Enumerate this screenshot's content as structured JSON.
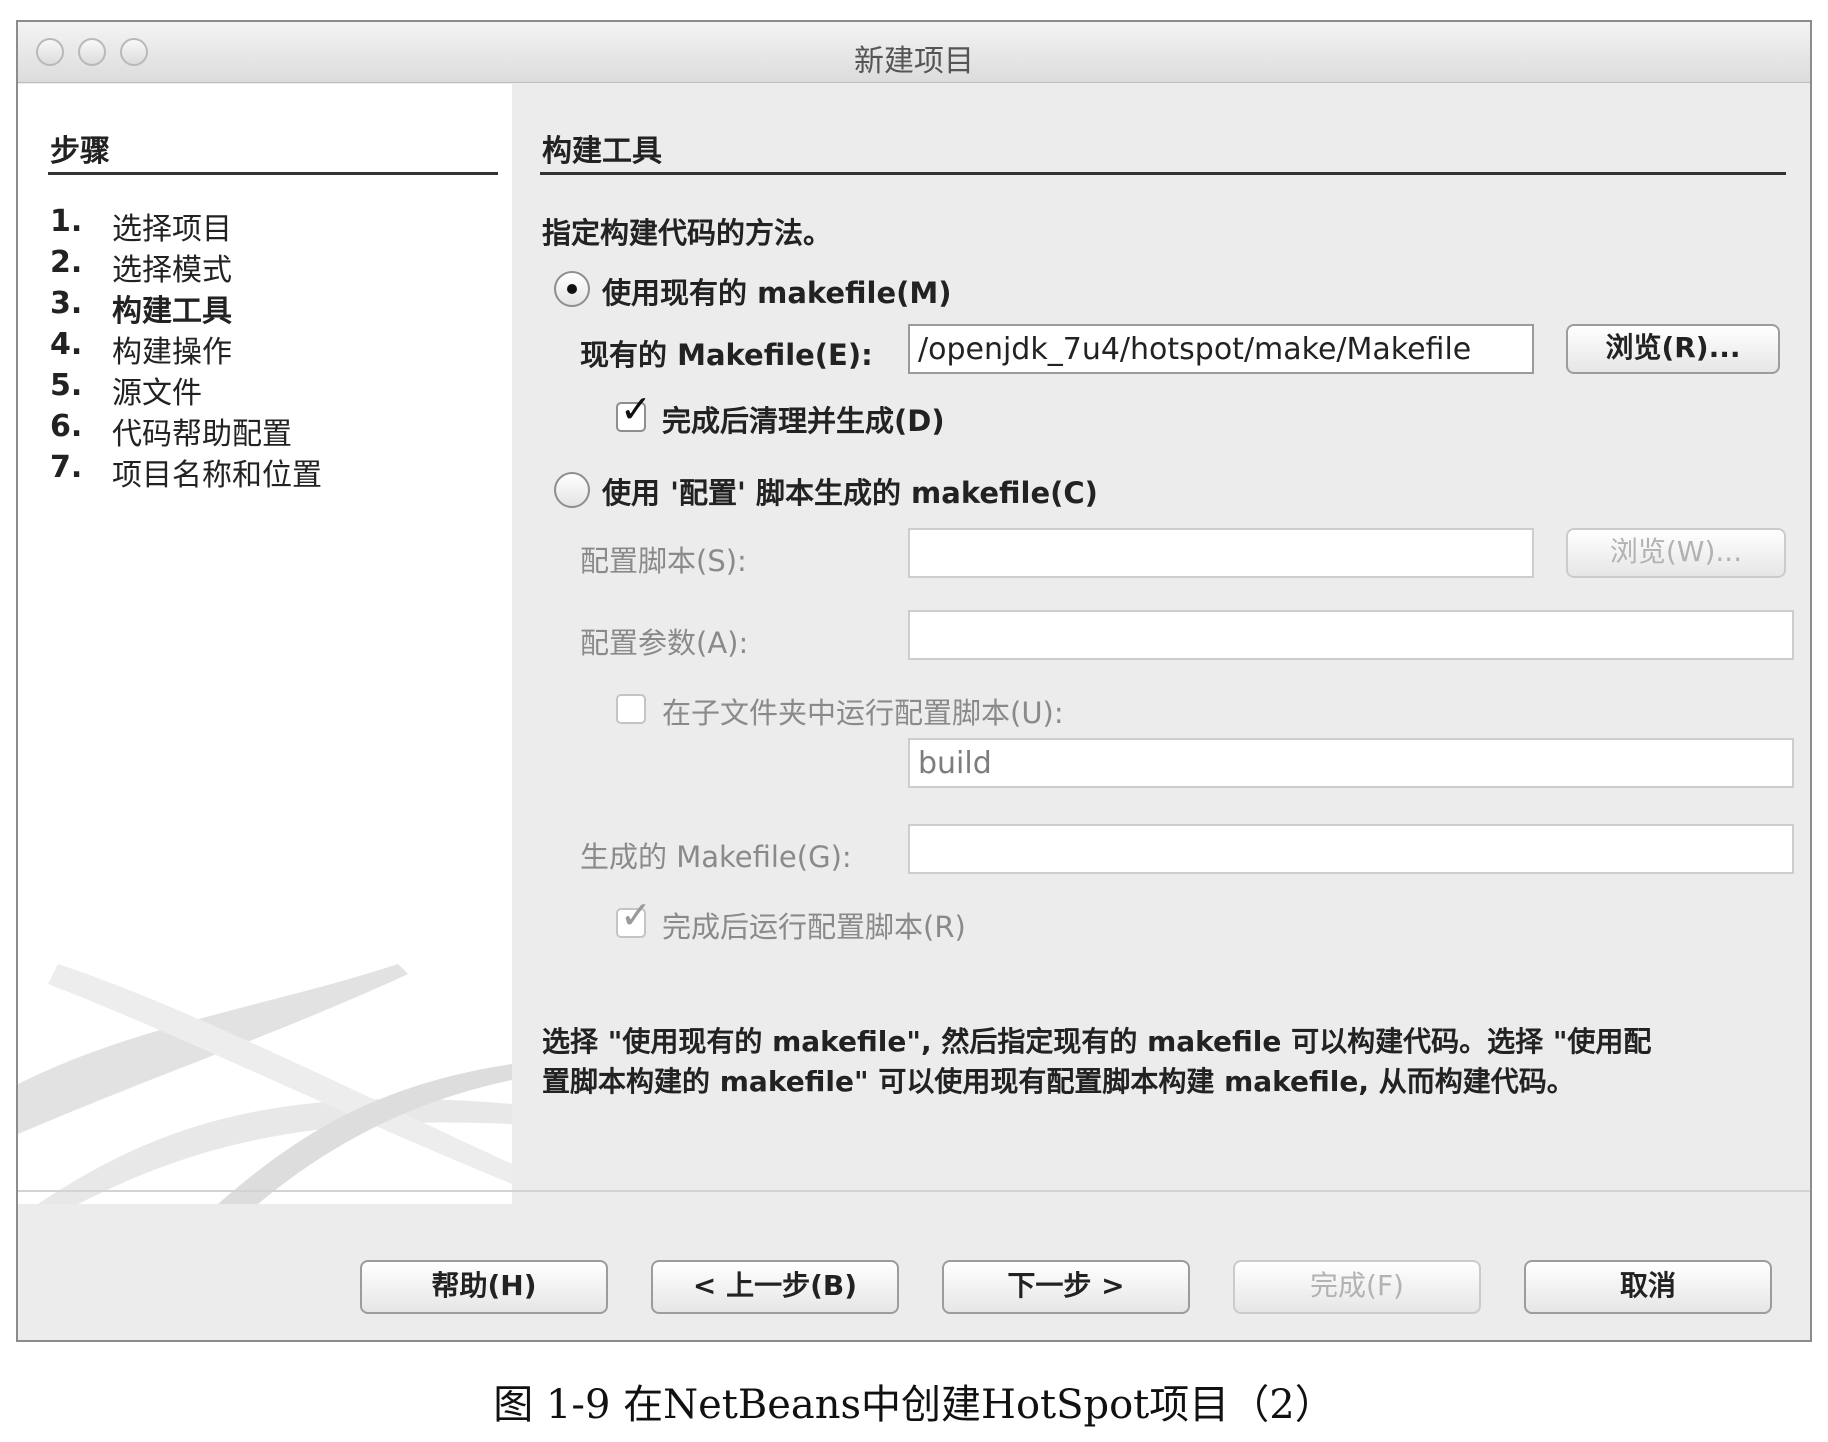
{
  "window": {
    "title": "新建项目"
  },
  "sidebar": {
    "heading": "步骤",
    "steps": [
      {
        "num": "1.",
        "label": "选择项目"
      },
      {
        "num": "2.",
        "label": "选择模式"
      },
      {
        "num": "3.",
        "label": "构建工具"
      },
      {
        "num": "4.",
        "label": "构建操作"
      },
      {
        "num": "5.",
        "label": "源文件"
      },
      {
        "num": "6.",
        "label": "代码帮助配置"
      },
      {
        "num": "7.",
        "label": "项目名称和位置"
      }
    ],
    "current_step": 3
  },
  "panel": {
    "heading": "构建工具",
    "instruction": "指定构建代码的方法。",
    "existing": {
      "radio_label": "使用现有的 makefile(M)",
      "selected": true,
      "makefile_label": "现有的 Makefile(E):",
      "makefile_value": "/openjdk_7u4/hotspot/make/Makefile",
      "browse_label": "浏览(R)...",
      "clean_build_label": "完成后清理并生成(D)",
      "clean_build_checked": true
    },
    "configure": {
      "radio_label": "使用 '配置' 脚本生成的 makefile(C)",
      "selected": false,
      "script_label": "配置脚本(S):",
      "script_value": "",
      "browse_label": "浏览(W)...",
      "args_label": "配置参数(A):",
      "args_value": "",
      "subfolder_label": "在子文件夹中运行配置脚本(U):",
      "subfolder_checked": false,
      "subfolder_value": "build",
      "generated_label": "生成的 Makefile(G):",
      "generated_value": "",
      "run_configure_label": "完成后运行配置脚本(R)",
      "run_configure_checked": true
    },
    "description_line1": "选择 \"使用现有的 makefile\", 然后指定现有的 makefile 可以构建代码。选择 \"使用配",
    "description_line2": "置脚本构建的 makefile\" 可以使用现有配置脚本构建 makefile, 从而构建代码。"
  },
  "footer": {
    "help": "帮助(H)",
    "back": "< 上一步(B)",
    "next": "下一步 >",
    "finish": "完成(F)",
    "cancel": "取消"
  },
  "caption": "图 1-9 在NetBeans中创建HotSpot项目（2）"
}
